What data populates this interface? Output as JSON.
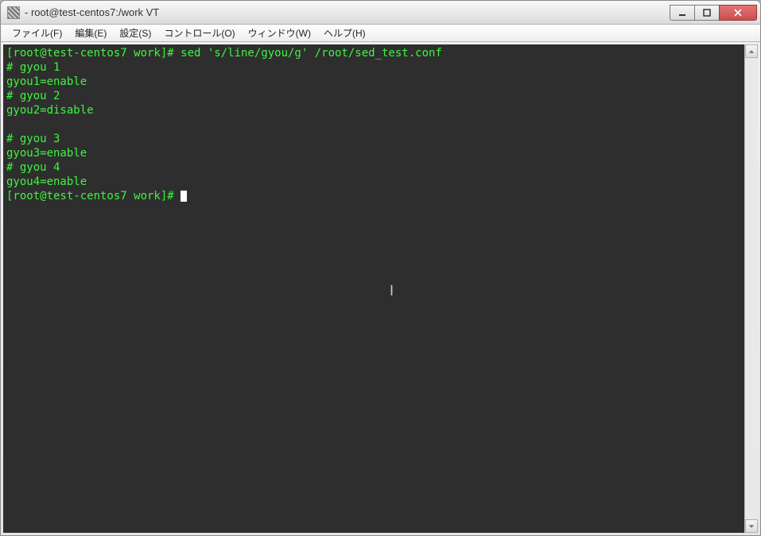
{
  "window": {
    "title": "- root@test-centos7:/work VT"
  },
  "menu": {
    "file": "ファイル(F)",
    "edit": "編集(E)",
    "settings": "設定(S)",
    "control": "コントロール(O)",
    "window": "ウィンドウ(W)",
    "help": "ヘルプ(H)"
  },
  "terminal": {
    "lines": [
      "[root@test-centos7 work]# sed 's/line/gyou/g' /root/sed_test.conf",
      "# gyou 1",
      "gyou1=enable",
      "# gyou 2",
      "gyou2=disable",
      "",
      "# gyou 3",
      "gyou3=enable",
      "# gyou 4",
      "gyou4=enable"
    ],
    "prompt": "[root@test-centos7 work]# "
  }
}
